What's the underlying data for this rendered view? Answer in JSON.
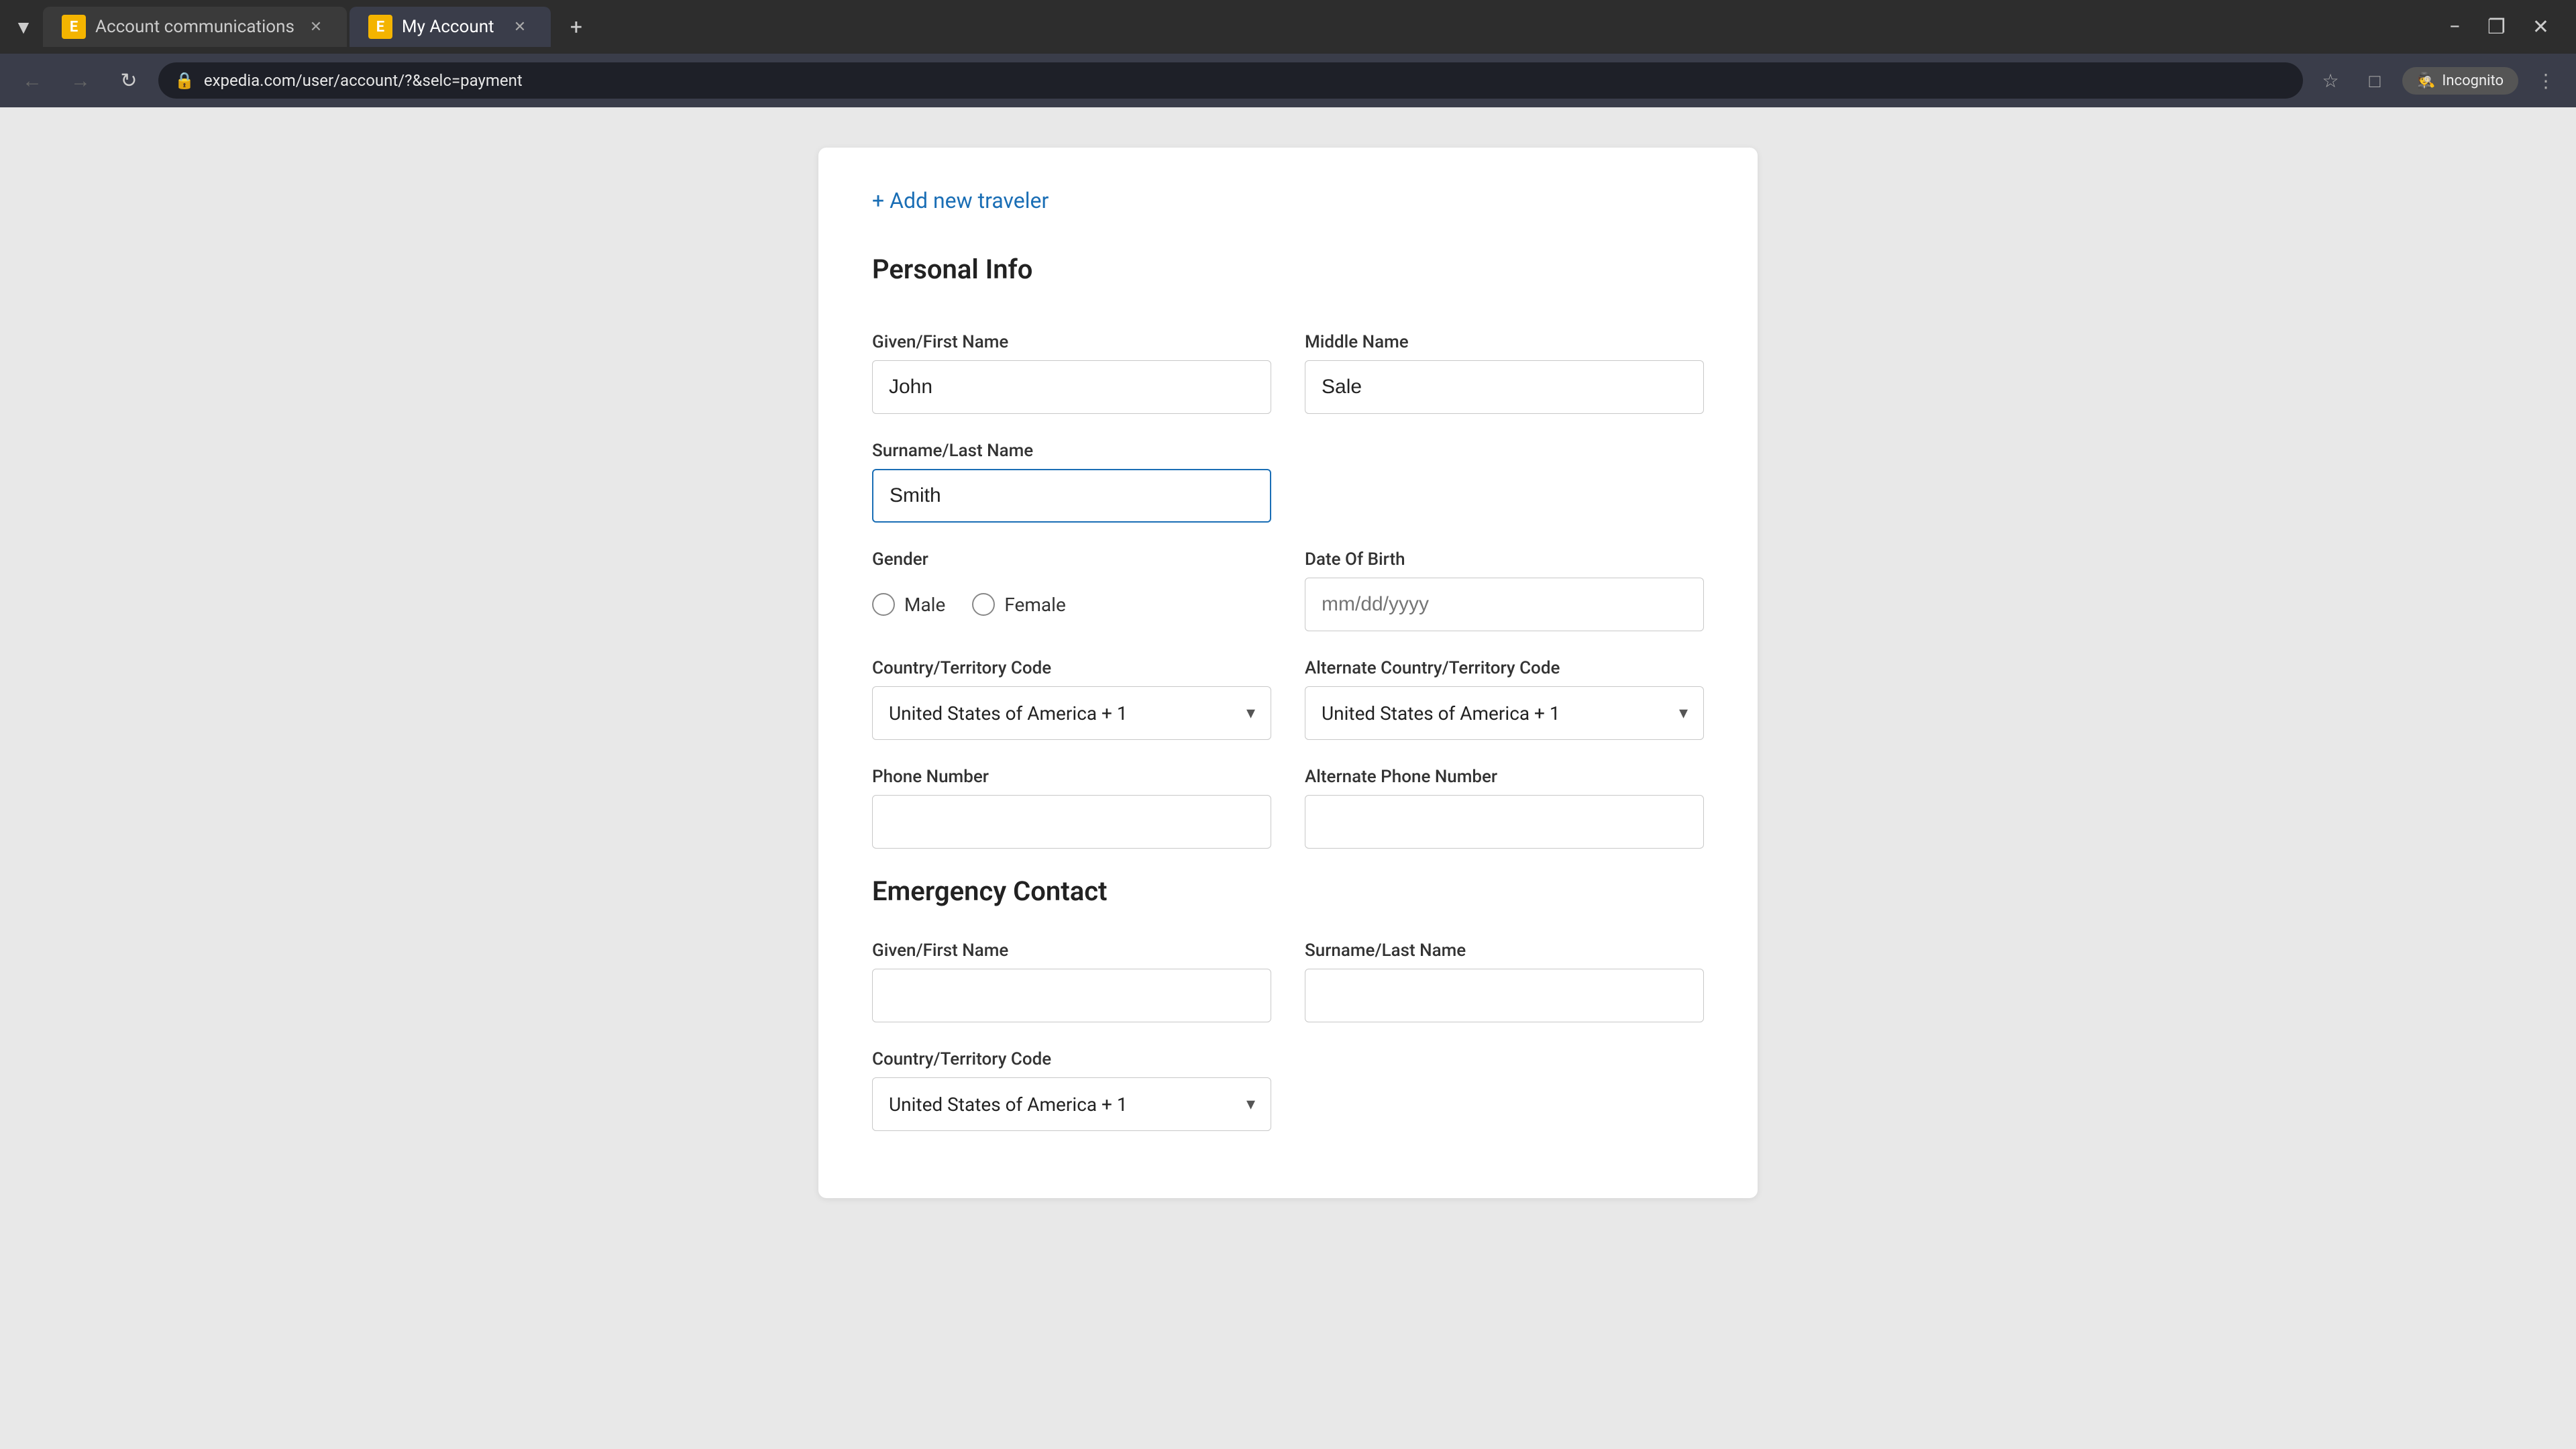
{
  "browser": {
    "tabs": [
      {
        "id": "tab-1",
        "label": "Account communications",
        "active": false,
        "icon": "E",
        "closeable": true
      },
      {
        "id": "tab-2",
        "label": "My Account",
        "active": true,
        "icon": "E",
        "closeable": true
      }
    ],
    "new_tab_label": "+",
    "window_controls": {
      "minimize": "−",
      "maximize": "❐",
      "close": "✕"
    },
    "nav": {
      "back": "←",
      "forward": "→",
      "refresh": "↻"
    },
    "address_bar": {
      "url": "expedia.com/user/account/?&selc=payment",
      "lock_icon": "🔒"
    },
    "actions": {
      "bookmark": "☆",
      "tab_search": "▭",
      "incognito_label": "Incognito",
      "more": "⋮"
    }
  },
  "page": {
    "add_traveler_link": "+ Add new traveler",
    "personal_info": {
      "section_title": "Personal Info",
      "given_first_name_label": "Given/First Name",
      "given_first_name_value": "John",
      "middle_name_label": "Middle Name",
      "middle_name_value": "Sale",
      "surname_last_name_label": "Surname/Last Name",
      "surname_last_name_value": "Smith",
      "gender_label": "Gender",
      "gender_options": [
        {
          "value": "male",
          "label": "Male"
        },
        {
          "value": "female",
          "label": "Female"
        }
      ],
      "date_of_birth_label": "Date Of Birth",
      "date_of_birth_placeholder": "mm/dd/yyyy",
      "country_territory_code_label": "Country/Territory Code",
      "country_territory_code_value": "United States of America + 1",
      "alt_country_territory_code_label": "Alternate Country/Territory Code",
      "alt_country_territory_code_value": "United States of America + 1",
      "phone_number_label": "Phone Number",
      "phone_number_value": "",
      "alt_phone_number_label": "Alternate Phone Number",
      "alt_phone_number_value": ""
    },
    "emergency_contact": {
      "section_title": "Emergency Contact",
      "given_first_name_label": "Given/First Name",
      "given_first_name_value": "",
      "surname_last_name_label": "Surname/Last Name",
      "surname_last_name_value": "",
      "country_territory_code_label": "Country/Territory Code",
      "country_territory_code_value": "United States of America + 1"
    }
  }
}
